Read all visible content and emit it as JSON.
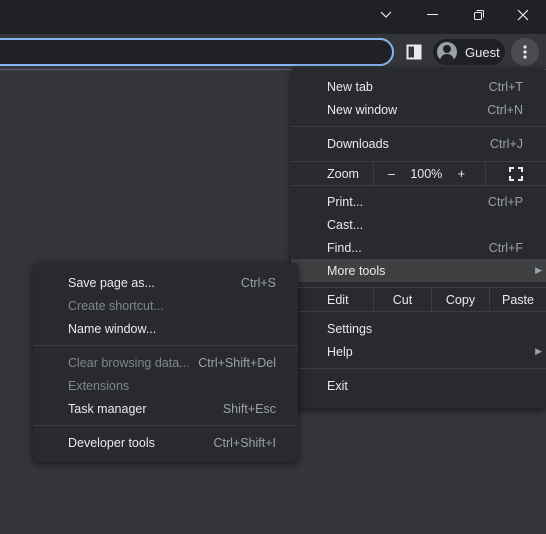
{
  "window": {
    "icons": [
      "tab-search-icon",
      "minimize-icon",
      "restore-icon",
      "close-icon"
    ]
  },
  "toolbar": {
    "profile_label": "Guest"
  },
  "main_menu": {
    "new_tab": {
      "label": "New tab",
      "shortcut": "Ctrl+T"
    },
    "new_window": {
      "label": "New window",
      "shortcut": "Ctrl+N"
    },
    "downloads": {
      "label": "Downloads",
      "shortcut": "Ctrl+J"
    },
    "zoom": {
      "label": "Zoom",
      "minus": "–",
      "value": "100%",
      "plus": "+"
    },
    "print": {
      "label": "Print...",
      "shortcut": "Ctrl+P"
    },
    "cast": {
      "label": "Cast..."
    },
    "find": {
      "label": "Find...",
      "shortcut": "Ctrl+F"
    },
    "more_tools": {
      "label": "More tools"
    },
    "edit": {
      "label": "Edit",
      "cut": "Cut",
      "copy": "Copy",
      "paste": "Paste"
    },
    "settings": {
      "label": "Settings"
    },
    "help": {
      "label": "Help"
    },
    "exit": {
      "label": "Exit"
    }
  },
  "sub_menu": {
    "save_page": {
      "label": "Save page as...",
      "shortcut": "Ctrl+S"
    },
    "create_shortcut": {
      "label": "Create shortcut..."
    },
    "name_window": {
      "label": "Name window..."
    },
    "clear_data": {
      "label": "Clear browsing data...",
      "shortcut": "Ctrl+Shift+Del"
    },
    "extensions": {
      "label": "Extensions"
    },
    "task_manager": {
      "label": "Task manager",
      "shortcut": "Shift+Esc"
    },
    "dev_tools": {
      "label": "Developer tools",
      "shortcut": "Ctrl+Shift+I"
    }
  }
}
